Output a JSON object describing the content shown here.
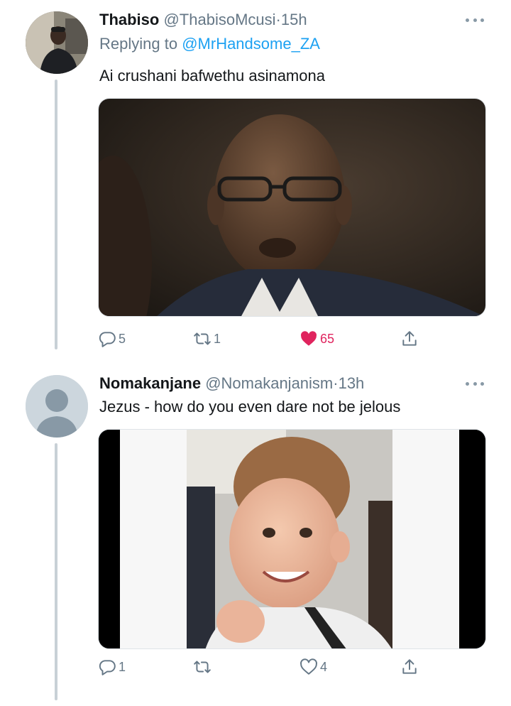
{
  "tweets": [
    {
      "name": "Thabiso",
      "handle": "@ThabisoMcusi",
      "dot": "·",
      "time": "15h",
      "replying_prefix": "Replying to",
      "replying_to": "@MrHandsome_ZA",
      "text": "Ai crushani bafwethu asinamona",
      "replies": "5",
      "retweets": "1",
      "likes": "65",
      "liked": true,
      "media_description": "photo of an older bald man in glasses with pursed lips"
    },
    {
      "name": "Nomakanjane",
      "handle": "@Nomakanjanism",
      "dot": "·",
      "time": "13h",
      "text": "Jezus - how do you even dare not be jelous",
      "replies": "1",
      "retweets": "",
      "likes": "4",
      "liked": false,
      "media_description": "photo of a smiling young boy"
    }
  ],
  "colors": {
    "like_active": "#e0245e",
    "link": "#1da1f2",
    "muted": "#657786",
    "thread_line": "#c8d0d6"
  }
}
